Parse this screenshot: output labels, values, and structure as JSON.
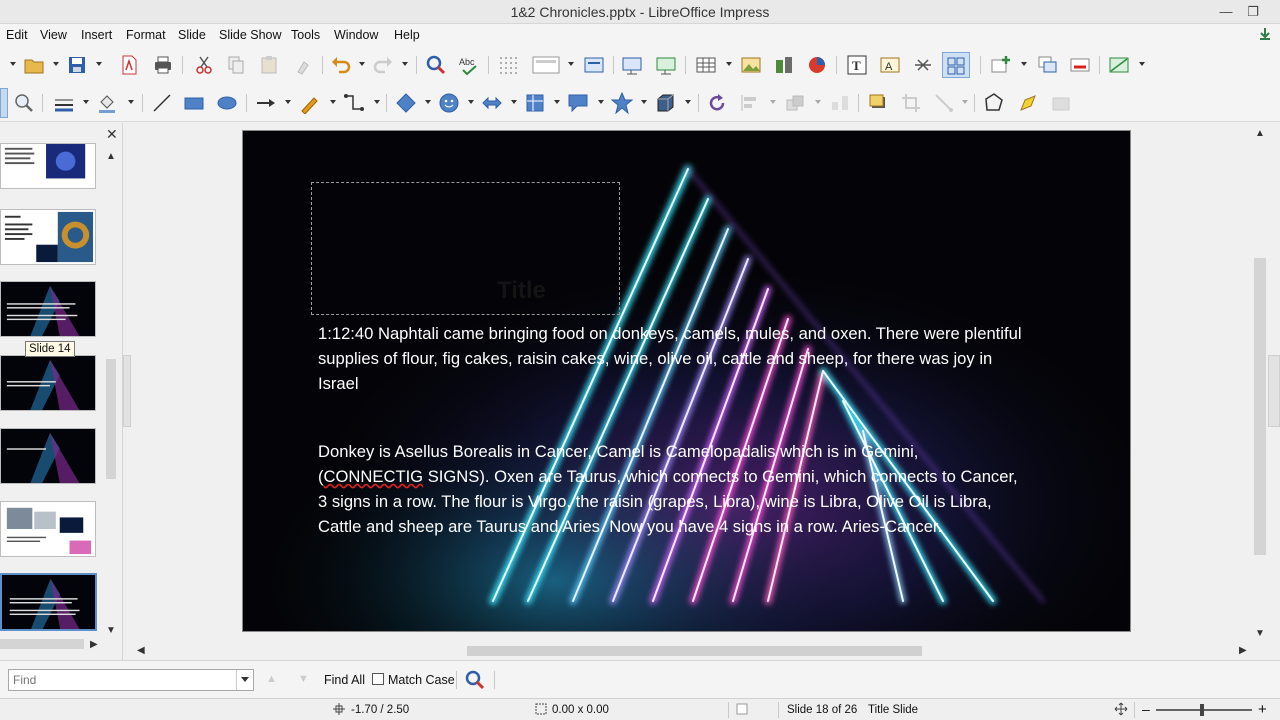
{
  "window": {
    "title": "1&2 Chronicles.pptx - LibreOffice Impress",
    "minimize": "—",
    "restore": "❐"
  },
  "menu": [
    "Edit",
    "View",
    "Insert",
    "Format",
    "Slide",
    "Slide Show",
    "Tools",
    "Window",
    "Help"
  ],
  "slide_pane": {
    "close_glyph": "✕",
    "tooltip": "Slide 14"
  },
  "slide": {
    "title_placeholder": "Title",
    "para1": "1:12:40 Naphtali came bringing food on donkeys, camels, mules, and oxen. There were plentiful supplies of flour, fig cakes, raisin cakes, wine, olive oil, cattle and sheep, for there was joy in Israel",
    "para2_a": "Donkey is Asellus Borealis in Cancer, Camel is Camelopadalis which is in Gemini, ",
    "para2_b": "CONNECTIG",
    "para2_c": " SIGNS). Oxen are Taurus, which connects to Gemini, which connects to Cancer, 3 signs in a row. The flour is Virgo, the raisin (grapes, Libra), wine is Libra, Olive Oil is Libra, Cattle and sheep are Taurus and Aries. Now you have 4 signs in a row. Aries-Cancer."
  },
  "findbar": {
    "placeholder": "Find",
    "find_all": "Find All",
    "match_case": "Match Case"
  },
  "status": {
    "position": "-1.70 / 2.50",
    "size": "0.00 x 0.00",
    "slide_counter": "Slide 18 of 26",
    "layout": "Title Slide",
    "zoom_plus": "+"
  },
  "colors": {
    "accent": "#5d8fc9",
    "neon_cyan": "#3ee6ff",
    "neon_pink": "#ff4fd8",
    "neon_purple": "#9d5cff"
  }
}
